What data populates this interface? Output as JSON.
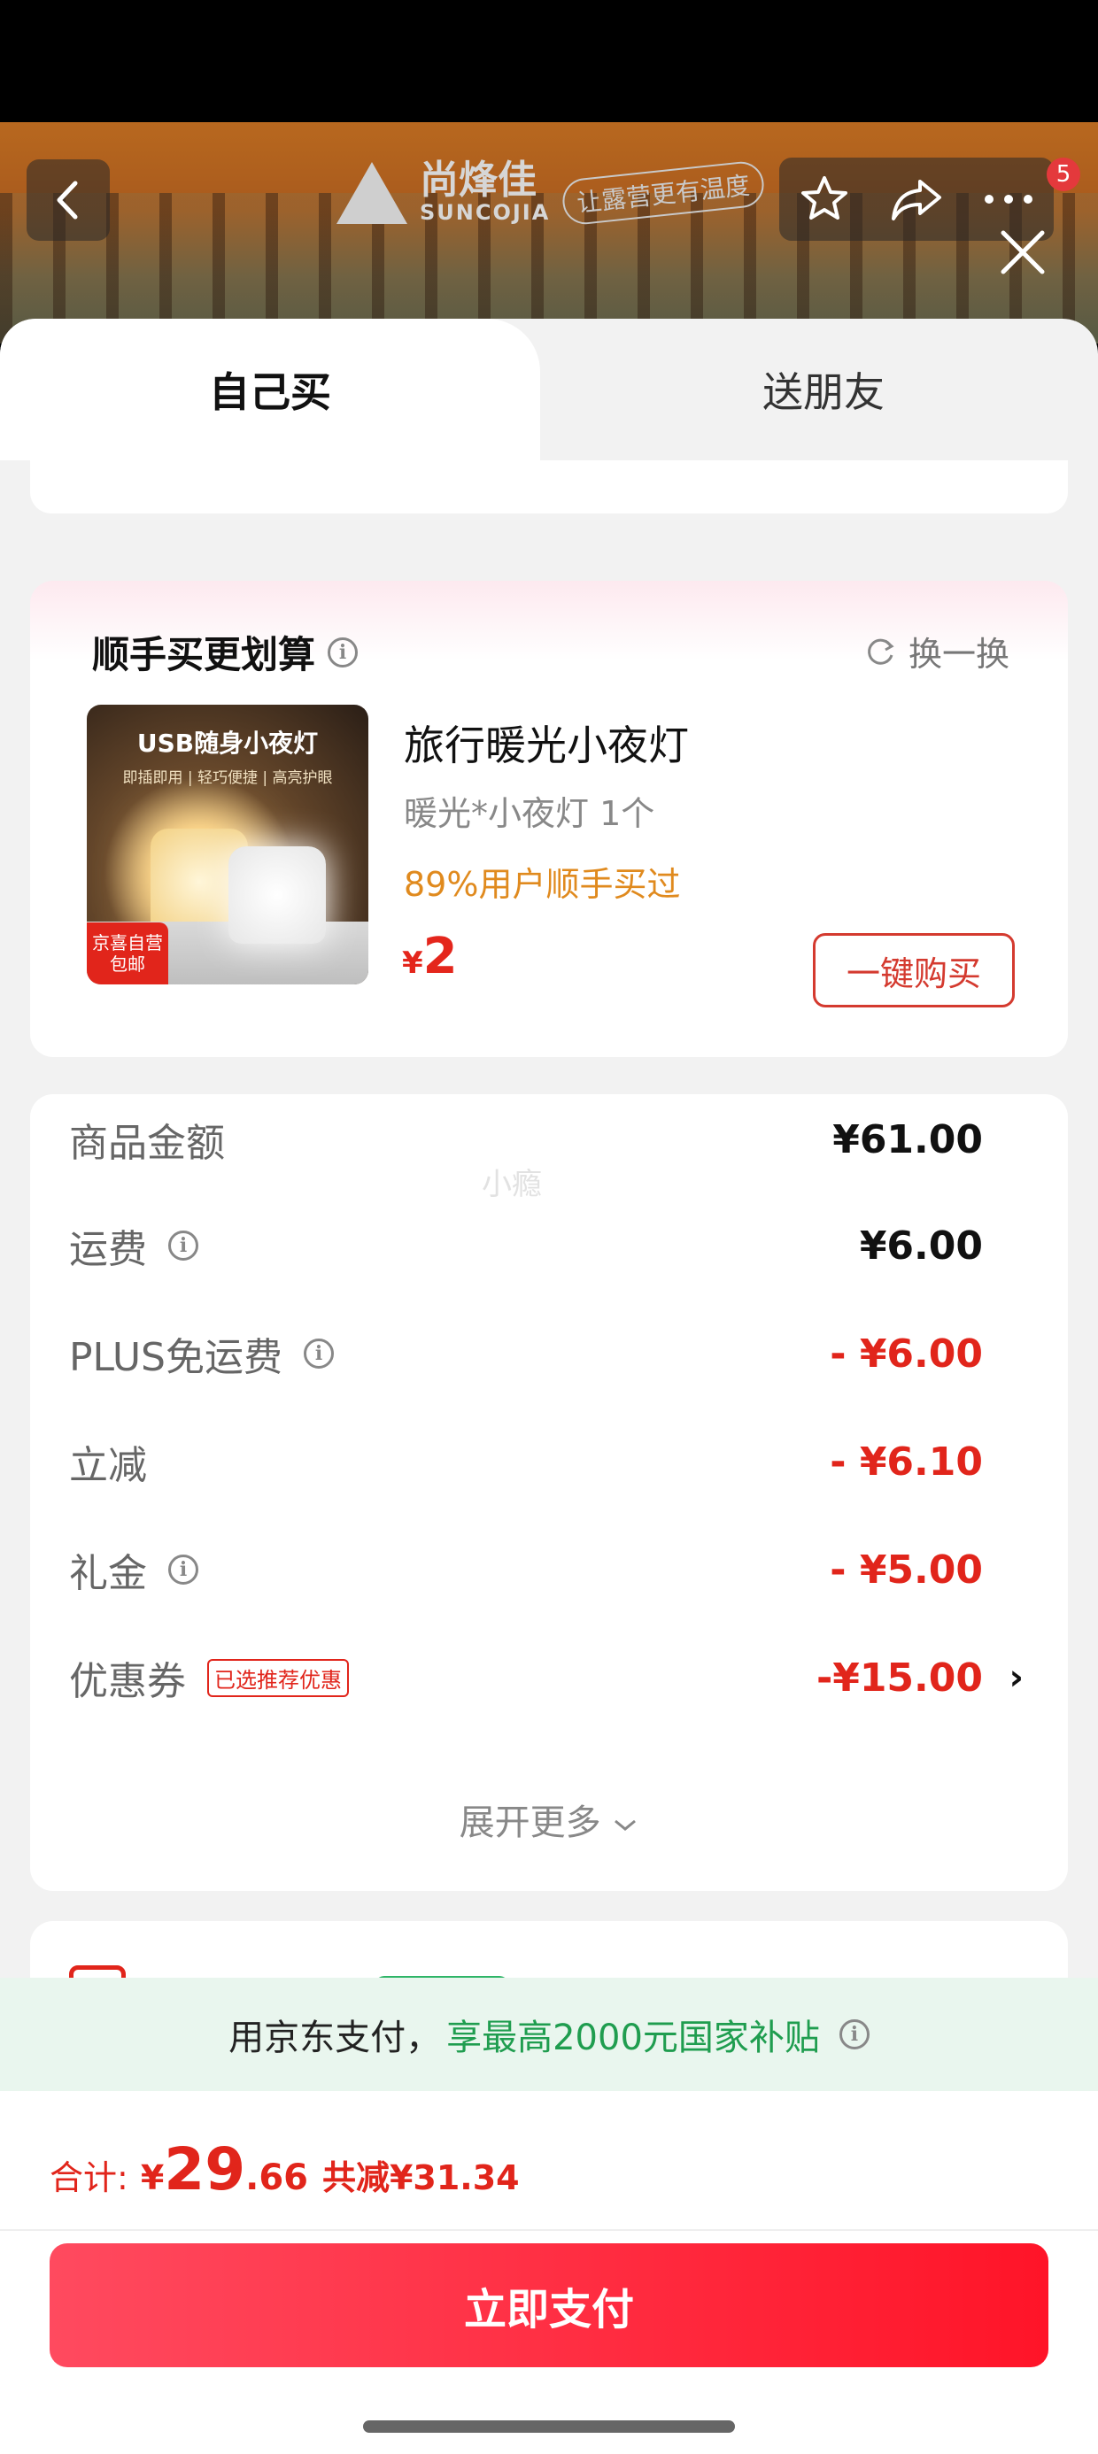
{
  "header": {
    "brand_name": "尚烽佳",
    "brand_sub": "SUNCOJIA",
    "brand_slogan": "让露营更有温度",
    "badge_count": "5"
  },
  "tabs": [
    {
      "label": "自己买",
      "active": true
    },
    {
      "label": "送朋友",
      "active": false
    }
  ],
  "bundle": {
    "title": "顺手买更划算",
    "refresh_label": "换一换",
    "image_title": "USB随身小夜灯",
    "image_sub": "即插即用 | 轻巧便捷 | 高亮护眼",
    "image_tag_line1": "京喜自营",
    "image_tag_line2": "包邮",
    "product_name": "旅行暖光小夜灯",
    "product_spec": "暖光*小夜灯   1个",
    "bought_text": "89%用户顺手买过",
    "price_currency": "¥",
    "price_value": "2",
    "buy_button": "一键购买"
  },
  "summary": {
    "watermark": "小瘾",
    "rows": [
      {
        "label": "商品金额",
        "value": "¥61.00"
      },
      {
        "label": "运费",
        "value": "¥6.00"
      },
      {
        "label": "PLUS免运费",
        "value": "- ¥6.00"
      },
      {
        "label": "立减",
        "value": "- ¥6.10"
      },
      {
        "label": "礼金",
        "value": "- ¥5.00"
      },
      {
        "label": "优惠券",
        "tag": "已选推荐优惠",
        "value": "-¥15.00",
        "chevron": "›"
      }
    ],
    "expand_label": "展开更多"
  },
  "subsidy": {
    "text_prefix": "用京东支付，",
    "text_highlight": "享最高2000元国家补贴"
  },
  "footer": {
    "total_label": "合计:",
    "total_currency": "¥",
    "total_int": "29",
    "total_dec": ".66",
    "saved_text": "共减¥31.34",
    "pay_button": "立即支付"
  },
  "colors": {
    "accent_red": "#e1251b",
    "subsidy_green": "#1f9d4f",
    "bought_orange": "#e08a1e"
  }
}
